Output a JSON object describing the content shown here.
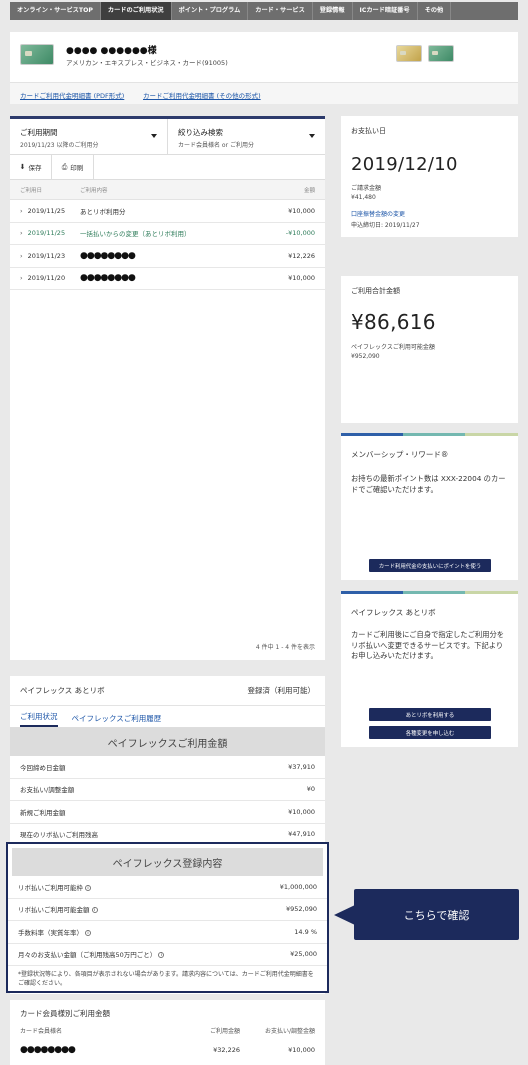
{
  "nav": {
    "items": [
      "オンライン・サービスTOP",
      "カードのご利用状況",
      "ポイント・プログラム",
      "カード・サービス",
      "登録情報",
      "ICカード暗証番号",
      "その他"
    ],
    "active_index": 1
  },
  "card": {
    "holder_name": "●●●● ●●●●●●様",
    "card_type": "アメリカン・エキスプレス・ビジネス・カード(91005)"
  },
  "links": {
    "pdf": "カードご利用代金明細書 (PDF形式)",
    "other": "カードご利用代金明細書 (その他の形式)"
  },
  "filters": {
    "period_title": "ご利用期間",
    "period_value": "2019/11/23 以降のご利用分",
    "search_title": "絞り込み検索",
    "search_value": "カード会員様名 or ご利用分"
  },
  "actions": {
    "save": "保存",
    "print": "印刷"
  },
  "table": {
    "headers": {
      "date": "ご利用日",
      "desc": "ご利用内容",
      "amount": "金額"
    },
    "rows": [
      {
        "date": "2019/11/25",
        "desc": "あとリボ利用分",
        "amount": "¥10,000",
        "green": false
      },
      {
        "date": "2019/11/25",
        "desc": "一括払いからの変更（あとリボ利用）",
        "amount": "-¥10,000",
        "green": true
      },
      {
        "date": "2019/11/23",
        "desc": "●●●●●●●●",
        "amount": "¥12,226",
        "green": false
      },
      {
        "date": "2019/11/20",
        "desc": "●●●●●●●●",
        "amount": "¥10,000",
        "green": false
      }
    ],
    "count": "4 件中 1 - 4 件を表示"
  },
  "payment": {
    "label": "お支払い日",
    "date": "2019/12/10",
    "billed_label": "ご請求金額",
    "billed_value": "¥41,480",
    "change_link": "口座振替金額の変更",
    "deadline": "申込締切日: 2019/11/27"
  },
  "total": {
    "label": "ご利用合計金額",
    "value": "¥86,616",
    "available_label": "ペイフレックスご利用可能金額",
    "available_value": "¥952,090"
  },
  "rewards": {
    "title": "メンバーシップ・リワード®",
    "text": "お持ちの最新ポイント数は XXX-22004 のカードでご確認いただけます。",
    "button": "カード利用代金の支払いにポイントを使う"
  },
  "atorevo": {
    "title": "ペイフレックス あとリボ",
    "text": "カードご利用後にご自身で指定したご利用分をリボ払いへ変更できるサービスです。下記よりお申し込みいただけます。",
    "button1": "あとリボを利用する",
    "button2": "各種変更を申し込む"
  },
  "payflex": {
    "title": "ペイフレックス あとリボ",
    "status": "登録済（利用可能）",
    "tab_usage": "ご利用状況",
    "tab_history": "ペイフレックスご利用履歴",
    "usage_header": "ペイフレックスご利用金額",
    "usage_rows": [
      {
        "label": "今回締め日金額",
        "value": "¥37,910"
      },
      {
        "label": "お支払い/調整金額",
        "value": "¥0"
      },
      {
        "label": "新規ご利用金額",
        "value": "¥10,000"
      },
      {
        "label": "現在のリボ払いご利用残高",
        "value": "¥47,910"
      }
    ],
    "reg_header": "ペイフレックス登録内容",
    "reg_rows": [
      {
        "label": "リボ払いご利用可能枠",
        "value": "¥1,000,000"
      },
      {
        "label": "リボ払いご利用可能金額",
        "value": "¥952,090"
      },
      {
        "label": "手数料率（実質年率）",
        "value": "14.9 %"
      },
      {
        "label": "月々のお支払い金額（ご利用残高50万円ごと）",
        "value": "¥25,000"
      }
    ],
    "note": "*登録状況等により、各項目が表示されない場合があります。請求内容については、カードご利用代金明細書をご確認ください。"
  },
  "callout": {
    "text": "こちらで確認"
  },
  "member": {
    "title": "カード会員様別ご利用金額",
    "h_name": "カード会員様名",
    "h_amount": "ご利用金額",
    "h_adjust": "お支払い/調整金額",
    "name": "●●●●●●●●",
    "amount": "¥32,226",
    "adjust": "¥10,000"
  },
  "colors": {
    "navy": "#1c2a5c",
    "link": "#1d56a8",
    "green": "#2e7c5a"
  }
}
